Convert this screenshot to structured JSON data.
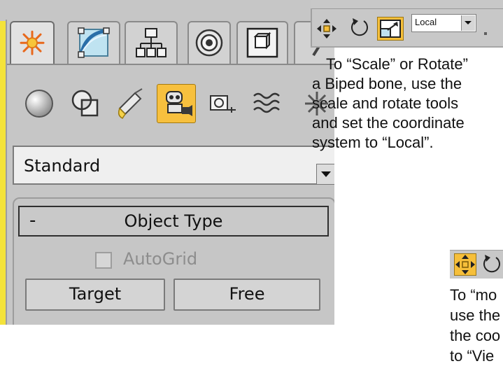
{
  "create_panel": {
    "tabs": [
      {
        "icon": "create-star-icon",
        "active": true
      },
      {
        "icon": "modify-icon",
        "active": false
      },
      {
        "icon": "hierarchy-icon",
        "active": false
      },
      {
        "icon": "motion-icon",
        "active": false
      },
      {
        "icon": "display-icon",
        "active": false
      }
    ],
    "categories": [
      {
        "icon": "geometry-sphere-icon",
        "active": false
      },
      {
        "icon": "shapes-icon",
        "active": false
      },
      {
        "icon": "lights-icon",
        "active": false
      },
      {
        "icon": "cameras-icon",
        "active": true
      },
      {
        "icon": "helpers-icon",
        "active": false
      },
      {
        "icon": "space-warps-icon",
        "active": false
      },
      {
        "icon": "systems-icon",
        "active": false
      }
    ],
    "dropdown_value": "Standard",
    "rollout": {
      "collapse_symbol": "-",
      "title": "Object Type",
      "autogrid_label": "AutoGrid",
      "autogrid_checked": false,
      "buttons": [
        "Target",
        "Free"
      ]
    }
  },
  "transform_toolbar": {
    "tools": [
      "move-icon",
      "rotate-icon",
      "scale-icon"
    ],
    "active_tool": "scale-icon",
    "coord_system": "Local"
  },
  "caption_scale_rotate": {
    "lines": [
      "To “Scale” or Rotate”",
      "a Biped bone, use the",
      "scale and rotate tools",
      "and set the coordinate",
      "system to “Local”."
    ]
  },
  "move_toolbar": {
    "tools": [
      "move-icon",
      "rotate-icon"
    ],
    "active_tool": "move-icon"
  },
  "caption_move": {
    "lines": [
      "To “mo",
      "use the",
      "the coo",
      "to “Vie"
    ]
  },
  "colors": {
    "highlight": "#f6bf3a",
    "panel": "#c6c6c6",
    "panel_edge": "#f4e33a"
  }
}
